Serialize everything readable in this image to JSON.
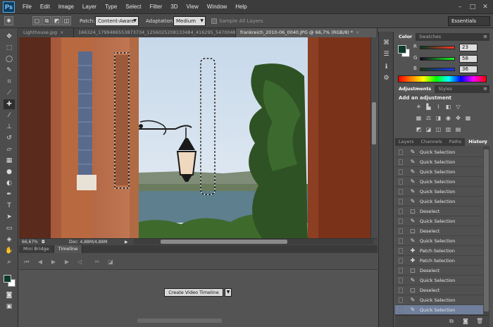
{
  "app": {
    "logo": "Ps"
  },
  "menu": [
    "File",
    "Edit",
    "Image",
    "Layer",
    "Type",
    "Select",
    "Filter",
    "3D",
    "View",
    "Window",
    "Help"
  ],
  "window_controls": [
    "–",
    "□",
    "✕"
  ],
  "options": {
    "patch_label": "Patch:",
    "patch_value": "Content-Aware",
    "adaptation_label": "Adaptation:",
    "adaptation_value": "Medium",
    "sample_all_layers": "Sample All Layers",
    "workspace": "Essentials"
  },
  "doc_tabs": [
    {
      "label": "Lighthouse.jpg",
      "active": false
    },
    {
      "label": "166324_1799486553873734_1256025208133484_416295_5470048_n.jpg",
      "active": false
    },
    {
      "label": "frankreich_2010-06_0040.JPG @ 66,7% (RGB/8) *",
      "active": true
    }
  ],
  "status": {
    "zoom": "66,67%",
    "doc": "Doc: 4,88M/4,88M"
  },
  "bottom_tabs": [
    {
      "label": "Mini Bridge",
      "active": false
    },
    {
      "label": "Timeline",
      "active": true
    }
  ],
  "timeline": {
    "create_button": "Create Video Timeline"
  },
  "color_panel": {
    "tabs": [
      {
        "label": "Color",
        "active": true
      },
      {
        "label": "Swatches",
        "active": false
      }
    ],
    "channels": [
      {
        "label": "R",
        "value": "23"
      },
      {
        "label": "G",
        "value": "58"
      },
      {
        "label": "B",
        "value": "36"
      }
    ],
    "fg_color": "#0f3b2a",
    "bg_color": "#ffffff"
  },
  "adjustments_panel": {
    "tabs": [
      {
        "label": "Adjustments",
        "active": true
      },
      {
        "label": "Styles",
        "active": false
      }
    ],
    "title": "Add an adjustment"
  },
  "layers_panel": {
    "tabs": [
      {
        "label": "Layers",
        "active": false
      },
      {
        "label": "Channels",
        "active": false
      },
      {
        "label": "Paths",
        "active": false
      },
      {
        "label": "History",
        "active": true
      }
    ]
  },
  "history": [
    {
      "icon": "brush",
      "label": "Quick Selection"
    },
    {
      "icon": "brush",
      "label": "Quick Selection"
    },
    {
      "icon": "brush",
      "label": "Quick Selection"
    },
    {
      "icon": "brush",
      "label": "Quick Selection"
    },
    {
      "icon": "brush",
      "label": "Quick Selection"
    },
    {
      "icon": "brush",
      "label": "Quick Selection"
    },
    {
      "icon": "doc",
      "label": "Deselect"
    },
    {
      "icon": "brush",
      "label": "Quick Selection"
    },
    {
      "icon": "doc",
      "label": "Deselect"
    },
    {
      "icon": "brush",
      "label": "Quick Selection"
    },
    {
      "icon": "patch",
      "label": "Patch Selection"
    },
    {
      "icon": "patch",
      "label": "Patch Selection"
    },
    {
      "icon": "doc",
      "label": "Deselect"
    },
    {
      "icon": "brush",
      "label": "Quick Selection"
    },
    {
      "icon": "doc",
      "label": "Deselect"
    },
    {
      "icon": "brush",
      "label": "Quick Selection"
    },
    {
      "icon": "brush",
      "label": "Quick Selection"
    }
  ]
}
